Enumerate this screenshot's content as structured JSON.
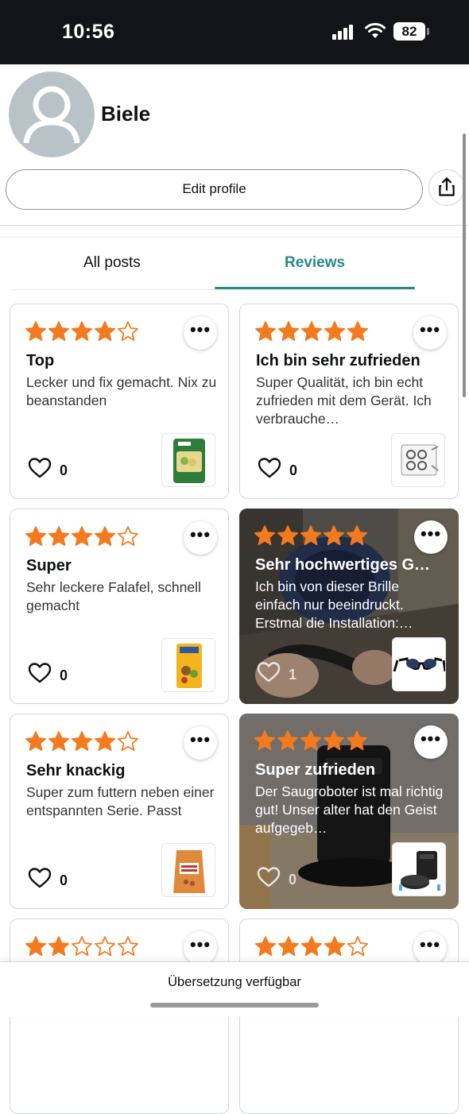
{
  "status_bar": {
    "time": "10:56",
    "battery": "82"
  },
  "profile": {
    "name": "Biele",
    "edit_label": "Edit profile"
  },
  "tabs": {
    "all_posts": "All posts",
    "reviews": "Reviews",
    "active": "reviews"
  },
  "colors": {
    "star": "#f47a1f",
    "accent": "#2a8a8a"
  },
  "reviews": [
    {
      "stars": 4,
      "title": "Top",
      "text": "Lecker und fix gemacht. Nix zu beanstanden",
      "likes": "0",
      "liked": false,
      "photo": false,
      "thumb": "instant-meal-package"
    },
    {
      "stars": 5,
      "title": "Ich bin sehr zufrieden",
      "text": "Super Qualität, ich bin echt zufrieden mit dem Gerät. Ich verbrauche…",
      "likes": "0",
      "liked": false,
      "photo": false,
      "thumb": "device-parts"
    },
    {
      "stars": 4,
      "title": "Super",
      "text": "Sehr leckere Falafel, schnell gemacht",
      "likes": "0",
      "liked": false,
      "photo": false,
      "thumb": "falafel-package"
    },
    {
      "stars": 5,
      "title": "Sehr hochwertiges G…",
      "text": "Ich bin von dieser Brille einfach nur beeindruckt. Erstmal die Installation:…",
      "likes": "1",
      "liked": false,
      "photo": true,
      "thumb": "smart-glasses"
    },
    {
      "stars": 4,
      "title": "Sehr knackig",
      "text": "Super zum futtern neben einer entspannten Serie. Passt",
      "likes": "0",
      "liked": false,
      "photo": false,
      "thumb": "peanut-bag"
    },
    {
      "stars": 5,
      "title": "Super zufrieden",
      "text": "Der Saugroboter ist mal richtig gut! Unser alter hat den Geist aufgegeb…",
      "likes": "0",
      "liked": false,
      "photo": true,
      "thumb": "robot-vacuum"
    },
    {
      "stars": 2,
      "title": "",
      "text": "",
      "likes": "",
      "liked": false,
      "photo": false,
      "thumb": ""
    },
    {
      "stars": 4,
      "title": "",
      "text": "",
      "likes": "",
      "liked": false,
      "photo": false,
      "thumb": ""
    }
  ],
  "translation_banner": "Übersetzung verfügbar"
}
